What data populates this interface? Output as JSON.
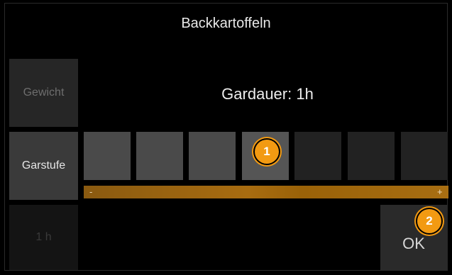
{
  "header": {
    "title": "Backkartoffeln"
  },
  "sidebar": {
    "weight_label": "Gewicht",
    "level_label": "Garstufe",
    "time_label": "1 h"
  },
  "main": {
    "duration_text": "Gardauer: 1h",
    "levels": {
      "count": 7,
      "selected_index": 3
    },
    "slider": {
      "min_label": "-",
      "max_label": "+"
    },
    "ok_label": "OK"
  },
  "annotations": {
    "marker_1": "1",
    "marker_2": "2"
  },
  "colors": {
    "accent": "#f29a12",
    "slider": "#a86c10",
    "background": "#000000"
  }
}
